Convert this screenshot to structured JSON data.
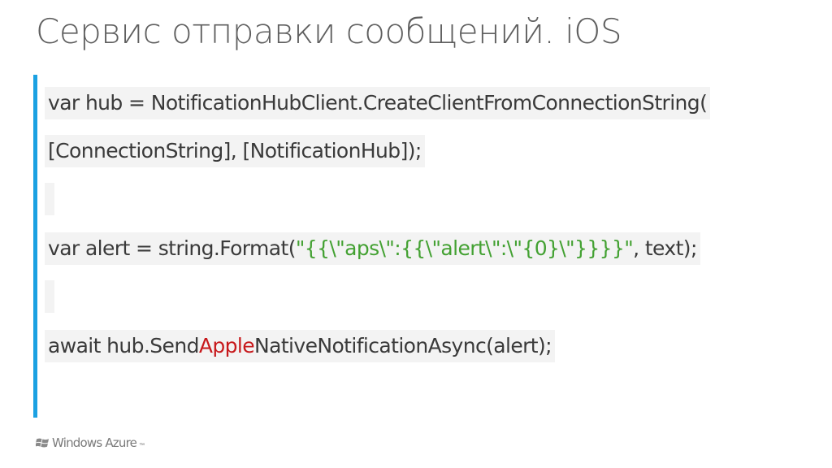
{
  "slide": {
    "title": "Сервис отправки сообщений. iOS",
    "accent_color": "#1ba1e2"
  },
  "code": {
    "line1": "var hub = NotificationHubClient.CreateClientFromConnectionString(",
    "line2": "[ConnectionString], [NotificationHub]);",
    "line3_prefix": "var alert = string.Format(",
    "line3_string": "\"{{\\\"aps\\\":{{\\\"alert\\\":\\\"{0}\\\"}}}}\"",
    "line3_suffix": ", text);",
    "line4_prefix": "await hub.Send",
    "line4_highlight": "Apple",
    "line4_suffix": "NativeNotificationAsync(alert);",
    "string_color": "#43a132",
    "highlight_color": "#c7191c"
  },
  "footer": {
    "logo_text": "Windows Azure",
    "logo_icon": "windows-flag-icon"
  }
}
